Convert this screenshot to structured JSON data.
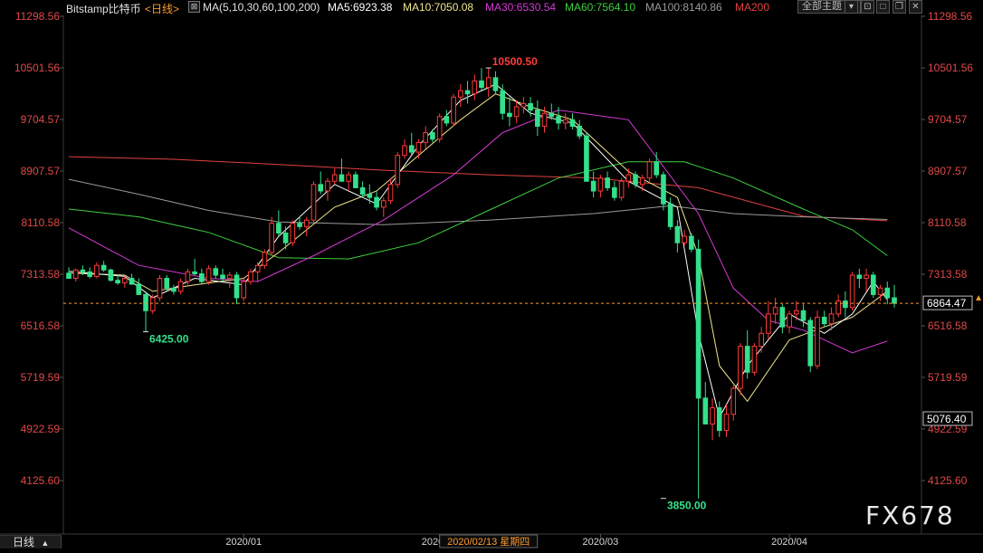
{
  "header": {
    "symbol": "Bitstamp比特币",
    "period_link": "<日线>",
    "indicator_name": "MA(5,10,30,60,100,200)",
    "ma5": "MA5:6923.38",
    "ma10": "MA10:7050.08",
    "ma30": "MA30:6530.54",
    "ma60": "MA60:7564.10",
    "ma100": "MA100:8140.86",
    "ma200": "MA200",
    "view_select": "全部主题",
    "view_select_icon": "dropdown-caret"
  },
  "footer": {
    "period_tab": "日线",
    "period_tab_icon": "triangle-up",
    "hover_date": "2020/02/13 星期四"
  },
  "brand": "FX678",
  "colors": {
    "up": "#ff3b3b",
    "down": "#33e08c",
    "ma5": "#ffffff",
    "ma10": "#f0e68c",
    "ma30": "#d53ad5",
    "ma60": "#3fcf3f",
    "ma100": "#9a9a9a",
    "ma200": "#e04040",
    "axis_text": "#e04848",
    "last_price_line": "#ff9a2e"
  },
  "chart_data": {
    "type": "candlestick",
    "ylim": [
      3850,
      11298.56
    ],
    "y_ticks": [
      "11298.56",
      "10501.56",
      "9704.57",
      "8907.57",
      "8110.58",
      "7313.58",
      "6516.58",
      "5719.59",
      "4922.59",
      "4125.60"
    ],
    "right_extra_labels": [
      "6864.47",
      "5076.40"
    ],
    "last_price": 6864.47,
    "x_labels": [
      "2020/01",
      "2020/02",
      "2020/03",
      "2020/04"
    ],
    "x_label_candle_index": [
      25,
      53,
      76,
      103
    ],
    "hover_candle_index": 60,
    "annotations": [
      {
        "text": "10500.50",
        "price": 10500.5,
        "candle_index": 60
      },
      {
        "text": "6425.00",
        "price": 6425.0,
        "candle_index": 11
      },
      {
        "text": "3850.00",
        "price": 3850.0,
        "candle_index": 85
      }
    ],
    "candles": [
      [
        7330,
        7420,
        7300,
        7250
      ],
      [
        7250,
        7400,
        7200,
        7380
      ],
      [
        7380,
        7450,
        7300,
        7350
      ],
      [
        7350,
        7420,
        7250,
        7280
      ],
      [
        7280,
        7500,
        7250,
        7450
      ],
      [
        7450,
        7520,
        7350,
        7380
      ],
      [
        7380,
        7400,
        7200,
        7220
      ],
      [
        7220,
        7300,
        7150,
        7180
      ],
      [
        7180,
        7280,
        7100,
        7250
      ],
      [
        7250,
        7320,
        7150,
        7160
      ],
      [
        7160,
        7250,
        7050,
        7000
      ],
      [
        7000,
        7050,
        6425,
        6750
      ],
      [
        6750,
        7000,
        6700,
        6950
      ],
      [
        6950,
        7300,
        6900,
        7250
      ],
      [
        7250,
        7300,
        7050,
        7100
      ],
      [
        7100,
        7150,
        7000,
        7050
      ],
      [
        7050,
        7250,
        7000,
        7200
      ],
      [
        7200,
        7400,
        7150,
        7350
      ],
      [
        7350,
        7550,
        7300,
        7320
      ],
      [
        7320,
        7400,
        7150,
        7200
      ],
      [
        7200,
        7450,
        7150,
        7400
      ],
      [
        7400,
        7450,
        7250,
        7300
      ],
      [
        7300,
        7400,
        7200,
        7250
      ],
      [
        7250,
        7350,
        7100,
        7300
      ],
      [
        7300,
        7350,
        6850,
        6950
      ],
      [
        6950,
        7250,
        6900,
        7200
      ],
      [
        7200,
        7400,
        7150,
        7350
      ],
      [
        7350,
        7500,
        7200,
        7450
      ],
      [
        7450,
        7700,
        7400,
        7650
      ],
      [
        7650,
        8200,
        7600,
        8100
      ],
      [
        8100,
        8300,
        7900,
        7950
      ],
      [
        7950,
        8050,
        7700,
        7800
      ],
      [
        7800,
        8150,
        7750,
        8100
      ],
      [
        8100,
        8200,
        8000,
        8050
      ],
      [
        8050,
        8200,
        7900,
        8150
      ],
      [
        8150,
        8750,
        8100,
        8700
      ],
      [
        8700,
        8900,
        8550,
        8600
      ],
      [
        8600,
        8800,
        8450,
        8750
      ],
      [
        8750,
        8950,
        8700,
        8850
      ],
      [
        8850,
        9100,
        8800,
        8750
      ],
      [
        8750,
        8900,
        8600,
        8850
      ],
      [
        8850,
        8900,
        8700,
        8650
      ],
      [
        8650,
        8750,
        8500,
        8550
      ],
      [
        8550,
        8700,
        8400,
        8500
      ],
      [
        8500,
        8600,
        8300,
        8350
      ],
      [
        8350,
        8500,
        8200,
        8450
      ],
      [
        8450,
        8800,
        8400,
        8700
      ],
      [
        8700,
        9200,
        8650,
        9150
      ],
      [
        9150,
        9400,
        9100,
        9300
      ],
      [
        9300,
        9500,
        9150,
        9200
      ],
      [
        9200,
        9400,
        9100,
        9350
      ],
      [
        9350,
        9600,
        9250,
        9500
      ],
      [
        9500,
        9550,
        9350,
        9400
      ],
      [
        9400,
        9800,
        9350,
        9750
      ],
      [
        9750,
        9850,
        9600,
        9650
      ],
      [
        9650,
        10100,
        9600,
        10050
      ],
      [
        10050,
        10250,
        9900,
        10150
      ],
      [
        10150,
        10300,
        9950,
        10100
      ],
      [
        10100,
        10400,
        10000,
        10300
      ],
      [
        10300,
        10500,
        10150,
        10200
      ],
      [
        10200,
        10500.5,
        10050,
        10350
      ],
      [
        10350,
        10450,
        10100,
        10150
      ],
      [
        10150,
        10250,
        9700,
        9800
      ],
      [
        9800,
        10050,
        9600,
        9750
      ],
      [
        9750,
        10000,
        9650,
        9900
      ],
      [
        9900,
        10050,
        9800,
        9950
      ],
      [
        9950,
        10050,
        9750,
        9850
      ],
      [
        9850,
        10000,
        9450,
        9600
      ],
      [
        9600,
        9900,
        9500,
        9800
      ],
      [
        9800,
        9950,
        9700,
        9750
      ],
      [
        9750,
        9900,
        9550,
        9650
      ],
      [
        9650,
        9800,
        9550,
        9700
      ],
      [
        9700,
        9800,
        9550,
        9600
      ],
      [
        9600,
        9700,
        9400,
        9450
      ],
      [
        9450,
        9500,
        8800,
        8750
      ],
      [
        8750,
        8900,
        8500,
        8600
      ],
      [
        8600,
        8850,
        8500,
        8800
      ],
      [
        8800,
        8900,
        8600,
        8650
      ],
      [
        8650,
        8750,
        8450,
        8500
      ],
      [
        8500,
        8800,
        8450,
        8750
      ],
      [
        8750,
        8950,
        8650,
        8850
      ],
      [
        8850,
        8900,
        8650,
        8700
      ],
      [
        8700,
        8850,
        8600,
        8800
      ],
      [
        8800,
        9100,
        8750,
        9050
      ],
      [
        9050,
        9200,
        8800,
        8850
      ],
      [
        8850,
        8900,
        8300,
        8400
      ],
      [
        8400,
        8500,
        8000,
        8050
      ],
      [
        8050,
        8150,
        7650,
        7800
      ],
      [
        7800,
        8000,
        7750,
        7900
      ],
      [
        7900,
        7950,
        7650,
        7700
      ],
      [
        7700,
        7850,
        3850,
        5400
      ],
      [
        5400,
        5650,
        5000,
        5000
      ],
      [
        5000,
        5400,
        4750,
        5250
      ],
      [
        5250,
        5350,
        4800,
        4900
      ],
      [
        4900,
        5300,
        4800,
        5150
      ],
      [
        5150,
        5600,
        5050,
        5550
      ],
      [
        5550,
        6250,
        5450,
        6200
      ],
      [
        6200,
        6450,
        5700,
        5800
      ],
      [
        5800,
        6250,
        5750,
        6200
      ],
      [
        6200,
        6500,
        6100,
        6400
      ],
      [
        6400,
        6900,
        6300,
        6700
      ],
      [
        6700,
        6950,
        6550,
        6800
      ],
      [
        6800,
        6850,
        6400,
        6500
      ],
      [
        6500,
        6750,
        6400,
        6700
      ],
      [
        6700,
        6900,
        6600,
        6750
      ],
      [
        6750,
        6850,
        6500,
        6600
      ],
      [
        6600,
        6650,
        5800,
        5900
      ],
      [
        5900,
        6750,
        5850,
        6650
      ],
      [
        6650,
        6750,
        6500,
        6550
      ],
      [
        6550,
        6800,
        6450,
        6700
      ],
      [
        6700,
        7000,
        6650,
        6900
      ],
      [
        6900,
        7050,
        6650,
        6800
      ],
      [
        6800,
        7350,
        6750,
        7300
      ],
      [
        7300,
        7400,
        7100,
        7250
      ],
      [
        7250,
        7400,
        7050,
        7300
      ],
      [
        7300,
        7350,
        6950,
        7000
      ],
      [
        7000,
        7150,
        6900,
        7100
      ],
      [
        7100,
        7200,
        6850,
        6950
      ],
      [
        6950,
        7150,
        6800,
        6864.47
      ]
    ],
    "ma_series": [
      {
        "name": "MA200",
        "key": "ma200",
        "values": [
          [
            0,
            9130
          ],
          [
            15,
            9090
          ],
          [
            30,
            9010
          ],
          [
            45,
            8920
          ],
          [
            60,
            8850
          ],
          [
            75,
            8800
          ],
          [
            90,
            8650
          ],
          [
            105,
            8210
          ],
          [
            117,
            8140
          ]
        ]
      },
      {
        "name": "MA100",
        "key": "ma100",
        "values": [
          [
            0,
            8780
          ],
          [
            10,
            8550
          ],
          [
            20,
            8300
          ],
          [
            30,
            8120
          ],
          [
            45,
            8080
          ],
          [
            60,
            8150
          ],
          [
            75,
            8250
          ],
          [
            86,
            8370
          ],
          [
            95,
            8250
          ],
          [
            105,
            8200
          ],
          [
            117,
            8160
          ]
        ]
      },
      {
        "name": "MA60",
        "key": "ma60",
        "values": [
          [
            0,
            8320
          ],
          [
            10,
            8200
          ],
          [
            20,
            7960
          ],
          [
            30,
            7570
          ],
          [
            40,
            7550
          ],
          [
            50,
            7800
          ],
          [
            60,
            8300
          ],
          [
            70,
            8800
          ],
          [
            80,
            9050
          ],
          [
            88,
            9050
          ],
          [
            95,
            8800
          ],
          [
            105,
            8320
          ],
          [
            112,
            8000
          ],
          [
            117,
            7600
          ]
        ]
      },
      {
        "name": "MA30",
        "key": "ma30",
        "values": [
          [
            0,
            8030
          ],
          [
            10,
            7450
          ],
          [
            20,
            7250
          ],
          [
            27,
            7200
          ],
          [
            35,
            7600
          ],
          [
            45,
            8150
          ],
          [
            55,
            8850
          ],
          [
            62,
            9500
          ],
          [
            70,
            9850
          ],
          [
            80,
            9700
          ],
          [
            90,
            8250
          ],
          [
            95,
            7100
          ],
          [
            100,
            6600
          ],
          [
            105,
            6450
          ],
          [
            112,
            6100
          ],
          [
            117,
            6280
          ]
        ]
      },
      {
        "name": "MA10",
        "key": "ma10",
        "values": [
          [
            0,
            7330
          ],
          [
            8,
            7300
          ],
          [
            12,
            7050
          ],
          [
            18,
            7150
          ],
          [
            25,
            7250
          ],
          [
            30,
            7650
          ],
          [
            38,
            8350
          ],
          [
            44,
            8600
          ],
          [
            50,
            9150
          ],
          [
            56,
            9700
          ],
          [
            61,
            10100
          ],
          [
            66,
            9900
          ],
          [
            72,
            9700
          ],
          [
            80,
            8900
          ],
          [
            87,
            8500
          ],
          [
            90,
            7600
          ],
          [
            93,
            5900
          ],
          [
            97,
            5350
          ],
          [
            103,
            6300
          ],
          [
            108,
            6500
          ],
          [
            112,
            6650
          ],
          [
            117,
            7050
          ]
        ]
      },
      {
        "name": "MA5",
        "key": "ma5",
        "values": [
          [
            0,
            7360
          ],
          [
            8,
            7280
          ],
          [
            12,
            6950
          ],
          [
            18,
            7250
          ],
          [
            25,
            7150
          ],
          [
            30,
            7900
          ],
          [
            38,
            8700
          ],
          [
            44,
            8400
          ],
          [
            50,
            9300
          ],
          [
            56,
            10000
          ],
          [
            61,
            10250
          ],
          [
            66,
            9800
          ],
          [
            72,
            9650
          ],
          [
            80,
            8750
          ],
          [
            87,
            8350
          ],
          [
            90,
            6400
          ],
          [
            93,
            5100
          ],
          [
            97,
            5900
          ],
          [
            103,
            6700
          ],
          [
            108,
            6400
          ],
          [
            112,
            6700
          ],
          [
            115,
            7200
          ],
          [
            117,
            6920
          ]
        ]
      }
    ]
  }
}
